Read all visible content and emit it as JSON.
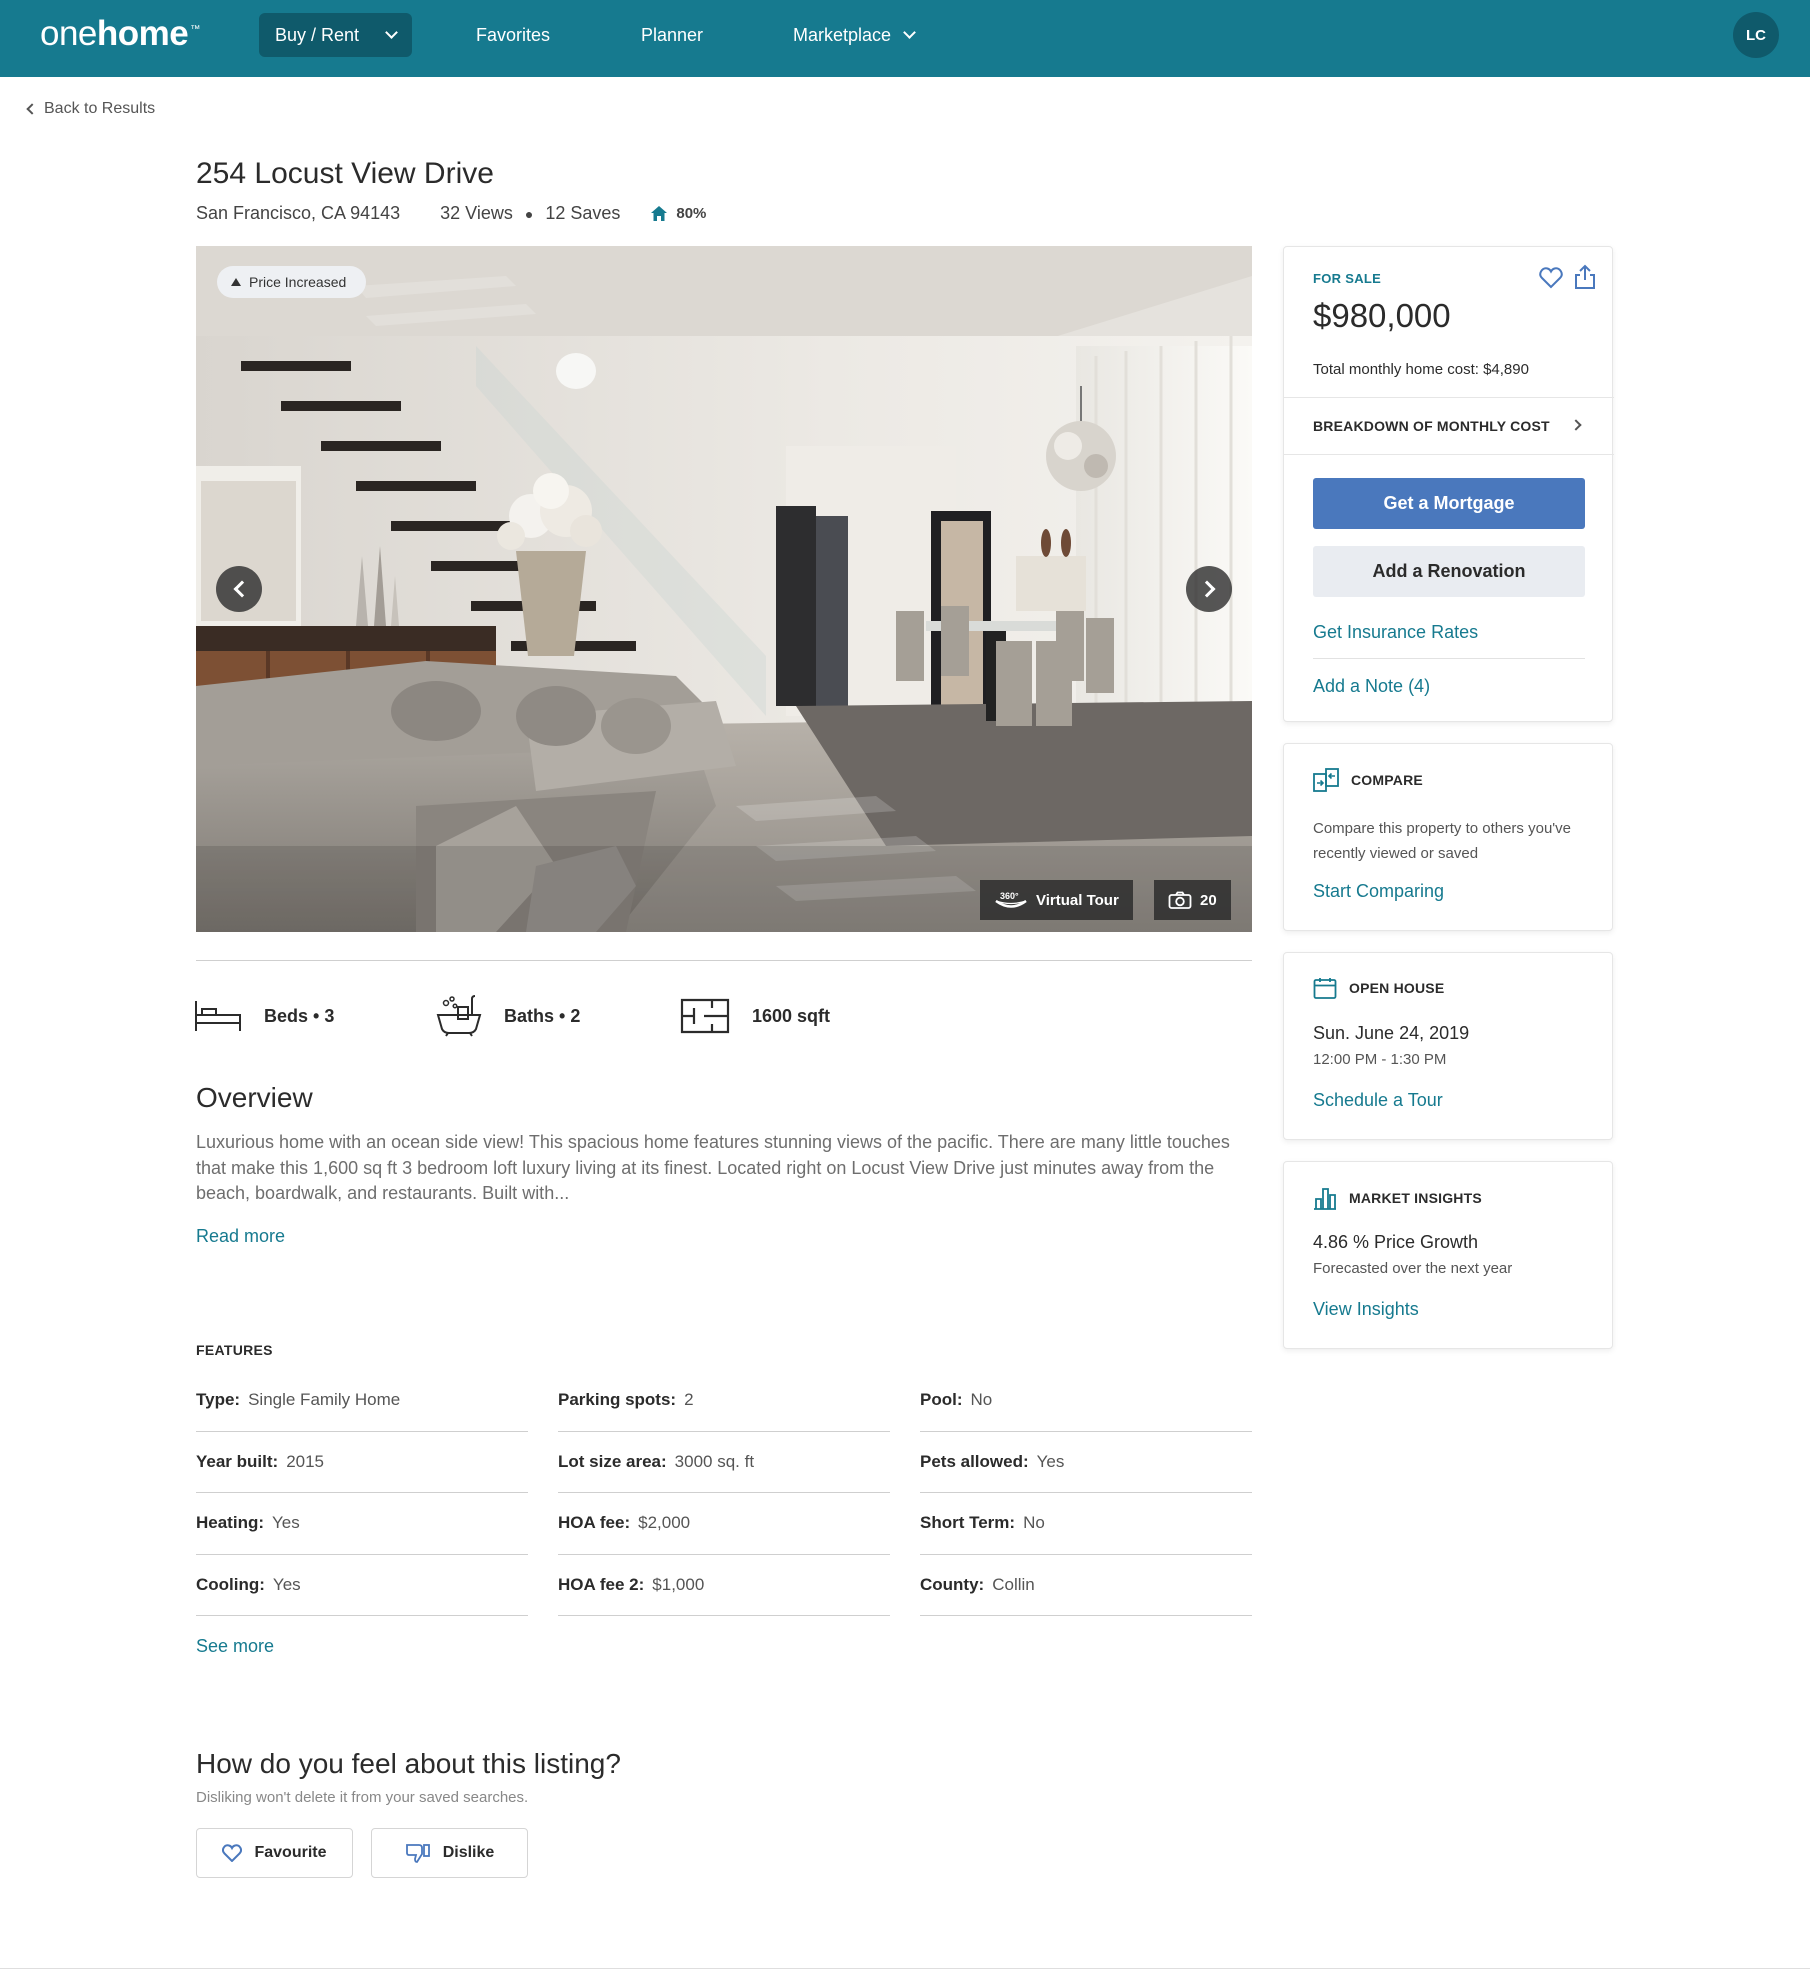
{
  "nav": {
    "logo_light": "one",
    "logo_bold": "home",
    "logo_tm": "™",
    "buy_rent": "Buy / Rent",
    "favorites": "Favorites",
    "planner": "Planner",
    "marketplace": "Marketplace",
    "avatar": "LC"
  },
  "back_label": "Back to Results",
  "listing": {
    "title": "254  Locust View Drive",
    "location": "San Francisco, CA 94143",
    "views": "32 Views",
    "saves": "12 Saves",
    "match": "80%",
    "badge": "Price Increased",
    "virtual_tour": "Virtual Tour",
    "tour_360": "360°",
    "photo_count": "20"
  },
  "stats": {
    "beds": "Beds • 3",
    "baths": "Baths • 2",
    "sqft": "1600 sqft"
  },
  "overview": {
    "heading": "Overview",
    "text": "Luxurious home with an ocean side view! This spacious home features stunning views of the pacific. There are many little touches that make this 1,600 sq ft 3 bedroom loft luxury living at its finest. Located right on Locust View Drive just minutes away from the beach, boardwalk, and restaurants. Built with...",
    "read_more": "Read more"
  },
  "features": {
    "title": "FEATURES",
    "items": [
      {
        "label": "Type:",
        "value": "Single Family Home"
      },
      {
        "label": "Parking spots:",
        "value": "2"
      },
      {
        "label": "Pool:",
        "value": "No"
      },
      {
        "label": "Year built:",
        "value": "2015"
      },
      {
        "label": "Lot size area:",
        "value": "3000 sq. ft"
      },
      {
        "label": "Pets allowed:",
        "value": "Yes"
      },
      {
        "label": "Heating:",
        "value": "Yes"
      },
      {
        "label": "HOA fee:",
        "value": "$2,000"
      },
      {
        "label": "Short Term:",
        "value": "No"
      },
      {
        "label": "Cooling:",
        "value": "Yes"
      },
      {
        "label": "HOA fee 2:",
        "value": "$1,000"
      },
      {
        "label": "County:",
        "value": "Collin"
      }
    ],
    "see_more": "See more"
  },
  "feeling": {
    "heading": "How do you feel about this listing?",
    "sub": "Disliking won't delete it from your saved searches.",
    "favourite": "Favourite",
    "dislike": "Dislike"
  },
  "price_card": {
    "status": "FOR SALE",
    "price": "$980,000",
    "monthly": "Total monthly home cost: $4,890",
    "breakdown": "BREAKDOWN OF MONTHLY COST",
    "mortgage": "Get a Mortgage",
    "renovation": "Add a Renovation",
    "insurance": "Get Insurance Rates",
    "note": "Add a Note (4)"
  },
  "compare_card": {
    "title": "COMPARE",
    "desc": "Compare this property to others you've recently viewed or saved",
    "link": "Start Comparing"
  },
  "open_house_card": {
    "title": "OPEN HOUSE",
    "date": "Sun. June 24, 2019",
    "time": "12:00 PM - 1:30 PM",
    "link": "Schedule a Tour"
  },
  "market_card": {
    "title": "MARKET INSIGHTS",
    "growth": "4.86 % Price Growth",
    "forecast": "Forecasted over the next year",
    "link": "View Insights"
  },
  "colors": {
    "brand": "#167a8f",
    "brand_dark": "#0f5a6b",
    "mortgage_button": "#4a78bd",
    "renovation_button": "#e9ecf1"
  }
}
